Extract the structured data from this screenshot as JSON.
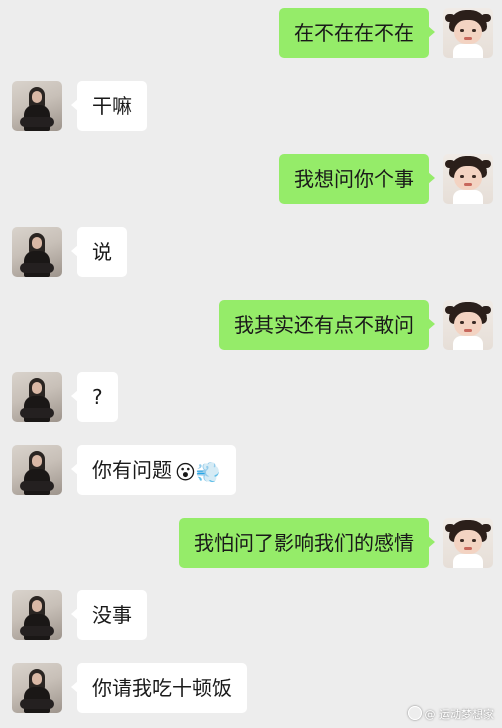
{
  "chat": {
    "messages": [
      {
        "sender": "me",
        "text": "在不在在不在"
      },
      {
        "sender": "her",
        "text": "干嘛"
      },
      {
        "sender": "me",
        "text": "我想问你个事"
      },
      {
        "sender": "her",
        "text": "说"
      },
      {
        "sender": "me",
        "text": "我其实还有点不敢问"
      },
      {
        "sender": "her",
        "text": "?"
      },
      {
        "sender": "her",
        "text": "你有问题",
        "emoji": "😮💨"
      },
      {
        "sender": "me",
        "text": "我怕问了影响我们的感情"
      },
      {
        "sender": "her",
        "text": "没事"
      },
      {
        "sender": "her",
        "text": "你请我吃十顿饭"
      }
    ]
  },
  "watermark": {
    "text": "@ 运动梦想家"
  },
  "colors": {
    "background": "#ededed",
    "self_bubble": "#95ec69",
    "other_bubble": "#ffffff",
    "text": "#191919"
  }
}
